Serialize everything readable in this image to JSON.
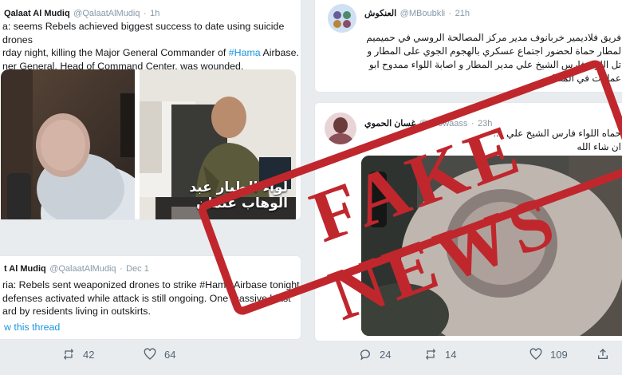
{
  "left_tweet_top": {
    "user": {
      "handle": "@QalaatAlMudiq",
      "time": "1h",
      "name": "Qalaat Al Mudiq"
    },
    "text_lines": [
      "a: seems Rebels achieved biggest success to date using suicide drones",
      "rday night, killing the Major General Commander of ",
      "ner General, Head of Command Center, was wounded."
    ],
    "hashtag": "#Hama",
    "hashtag_suffix": " Airbase.",
    "photo_caption": "لواء الطيار عبد الوهاب عثمان"
  },
  "left_tweet_bottom": {
    "user": {
      "name": "t Al Mudiq",
      "handle": "@QalaatAlMudiq",
      "time": "Dec 1"
    },
    "text_lines": [
      "ria: Rebels sent weaponized drones to strike #Hama Airbase tonight.",
      "defenses activated while attack is still ongoing. One massive blast",
      "ard by residents living in outskirts."
    ],
    "show_thread": "w this thread",
    "actions": {
      "retweets": "42",
      "likes": "64"
    }
  },
  "right_tweet_top": {
    "user": {
      "name": "العنكوش",
      "handle": "@MBoubkli",
      "time": "21h"
    },
    "text_lines": [
      "فريق فلاديمير خربانوف مدير مركز المصالحة الروسي في حميميم",
      "لمطار حماة لحضور اجتماع عسكري بالهجوم الجوي على المطار و",
      "تل اللواء فارس الشيخ علي مدير المطار و اصابة اللواء ممدوح ابو",
      "عمليات في المطار"
    ]
  },
  "right_tweet_bottom": {
    "user": {
      "name": "غسان الحموي",
      "handle": "@abowaass",
      "time": "23h"
    },
    "text_lines": [
      "حماه اللواء فارس الشيخ علي ....",
      "ان شاء الله"
    ],
    "actions": {
      "replies": "24",
      "retweets": "14",
      "likes": "109"
    }
  },
  "stamp": {
    "text": "FAKE NEWS",
    "color": "#c0272d"
  },
  "colors": {
    "link": "#1b95e0",
    "muted": "#8899a6"
  }
}
